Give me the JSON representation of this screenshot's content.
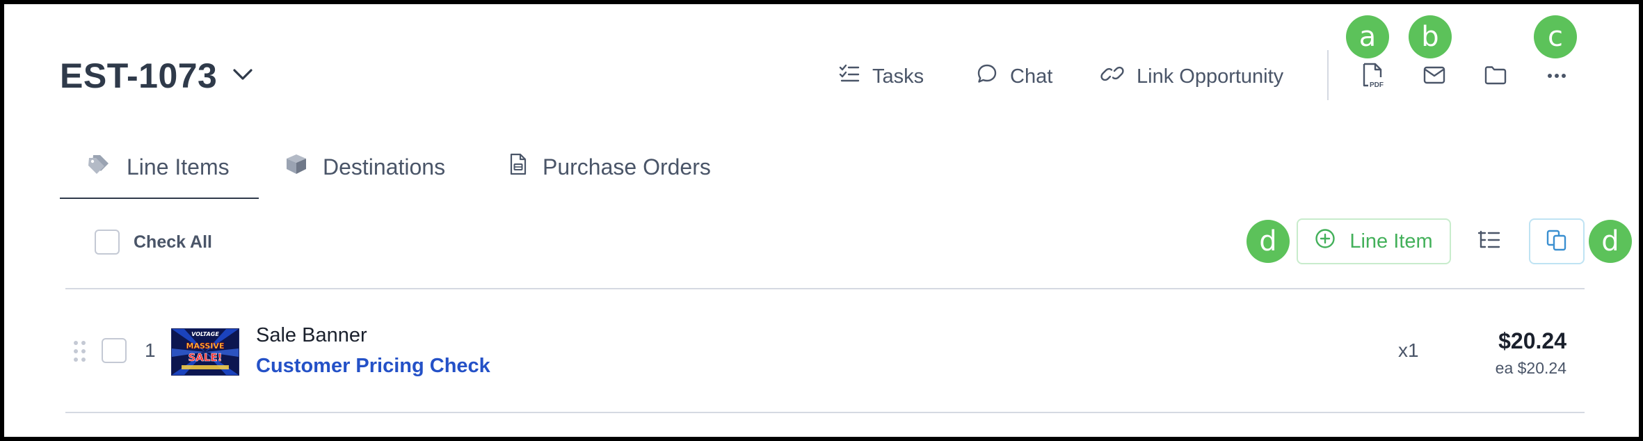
{
  "estimate": {
    "title": "EST-1073"
  },
  "header_actions": {
    "tasks_label": "Tasks",
    "chat_label": "Chat",
    "link_opportunity_label": "Link Opportunity",
    "pdf_icon_text": "PDF"
  },
  "badges": {
    "pdf": "a",
    "email": "b",
    "more": "c",
    "add_line_item": "d",
    "copy": "d"
  },
  "tabs": [
    {
      "label": "Line Items",
      "icon": "tag-icon",
      "active": true
    },
    {
      "label": "Destinations",
      "icon": "box-icon",
      "active": false
    },
    {
      "label": "Purchase Orders",
      "icon": "document-icon",
      "active": false
    }
  ],
  "toolbar": {
    "check_all_label": "Check All",
    "add_line_item_label": "Line Item"
  },
  "line_items": [
    {
      "number": "1",
      "name": "Sale Banner",
      "link_text": "Customer Pricing Check",
      "quantity": "x1",
      "total": "$20.24",
      "unit_price": "ea $20.24",
      "thumbnail_text": {
        "top": "VOLTAGE",
        "middle": "MASSIVE",
        "bottom": "SALE!"
      }
    }
  ],
  "colors": {
    "badge_green": "#5cc25a",
    "add_button_green": "#43b05a",
    "link_blue": "#2451c7",
    "copy_icon_blue": "#3a8fd0",
    "text_dark": "#2f3a4a",
    "text_muted": "#4a5568"
  }
}
